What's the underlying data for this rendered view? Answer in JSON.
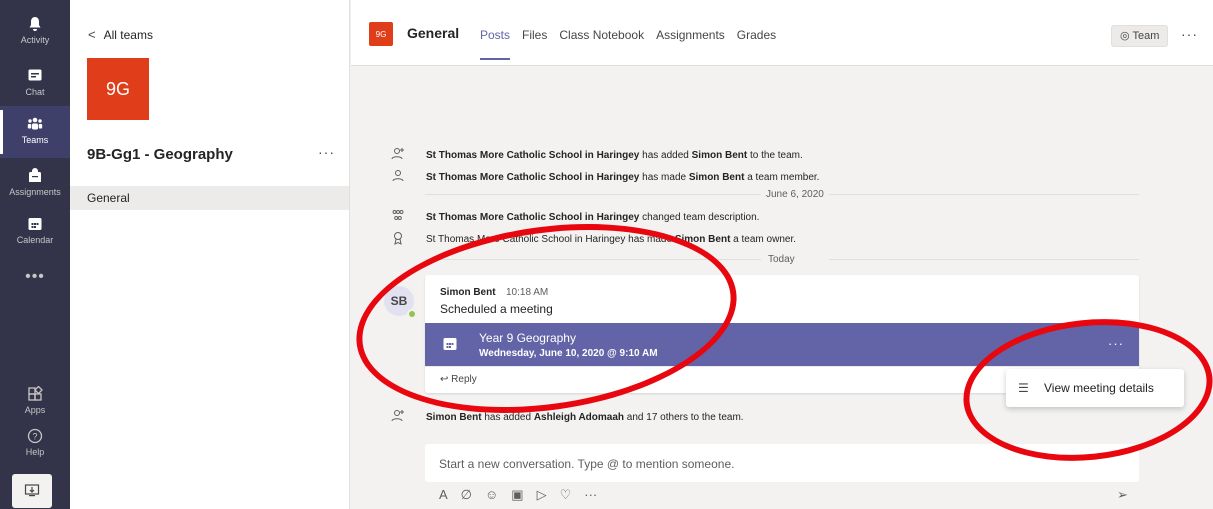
{
  "appbar": {
    "items": [
      {
        "label": "Activity",
        "icon": "bell-icon"
      },
      {
        "label": "Chat",
        "icon": "chat-icon"
      },
      {
        "label": "Teams",
        "icon": "teams-icon"
      },
      {
        "label": "Assignments",
        "icon": "assignments-icon"
      },
      {
        "label": "Calendar",
        "icon": "calendar-icon"
      }
    ],
    "more": "•••",
    "bottom": [
      {
        "label": "Apps",
        "icon": "apps-icon"
      },
      {
        "label": "Help",
        "icon": "help-icon"
      }
    ]
  },
  "teampanel": {
    "back_label": "All teams",
    "logo_text": "9G",
    "team_name": "9B-Gg1 - Geography",
    "more": "···",
    "channel": "General"
  },
  "header": {
    "badge": "9G",
    "title": "General",
    "tabs": [
      "Posts",
      "Files",
      "Class Notebook",
      "Assignments",
      "Grades"
    ],
    "team_button": "Team",
    "more": "···"
  },
  "feed": {
    "events": [
      {
        "actor": "St Thomas More Catholic School in Haringey",
        "text1": " has added ",
        "target": "Simon Bent",
        "text2": " to the team."
      },
      {
        "actor": "St Thomas More Catholic School in Haringey",
        "text1": " has made ",
        "target": "Simon Bent",
        "text2": " a team member."
      },
      {
        "actor": "St Thomas More Catholic School in Haringey",
        "text1": " changed team description.",
        "target": "",
        "text2": ""
      },
      {
        "actor": "St Thomas More Catholic School in Haringey",
        "text1": " has made ",
        "target": "Simon Bent",
        "text2": " a team owner."
      }
    ],
    "date_june": "June 6, 2020",
    "date_today": "Today",
    "post": {
      "avatar": "SB",
      "author": "Simon Bent",
      "time": "10:18 AM",
      "body": "Scheduled a meeting",
      "meeting_title": "Year 9 Geography",
      "meeting_time": "Wednesday, June 10, 2020 @ 9:10 AM",
      "more": "···",
      "reply": "Reply"
    },
    "context_menu": {
      "item": "View meeting details"
    },
    "last_event": {
      "actor": "Simon Bent",
      "text1": " has added ",
      "target": "Ashleigh Adomaah",
      "text2": " and 17 others to the team."
    },
    "compose_placeholder": "Start a new conversation. Type @ to mention someone.",
    "toolbar_more": "···"
  }
}
